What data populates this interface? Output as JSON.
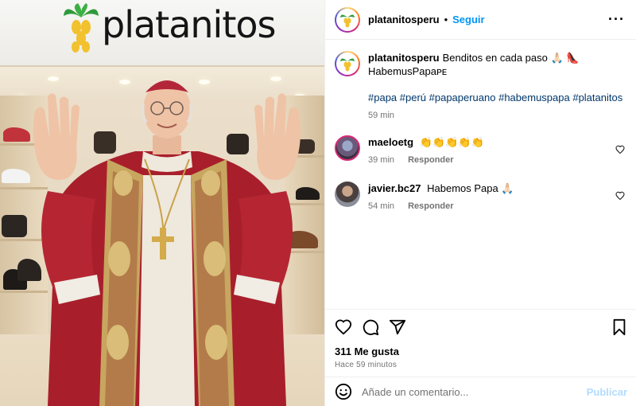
{
  "image": {
    "store_name": "platanitos"
  },
  "header": {
    "username": "platanitosperu",
    "separator": "•",
    "follow_label": "Seguir",
    "more": "···"
  },
  "caption": {
    "username": "platanitosperu",
    "text": "Benditos en cada paso 🙏🏻 👠",
    "text2": "HabemusPapaᴘᴇ",
    "hashtags": "#papa #perú #papaperuano #habemuspapa #platanitos",
    "time": "59 min"
  },
  "comments": [
    {
      "username": "maeloetg",
      "text": "👏👏👏👏👏",
      "time": "39 min",
      "reply": "Responder"
    },
    {
      "username": "javier.bc27",
      "text": "Habemos Papa 🙏🏻",
      "time": "54 min",
      "reply": "Responder"
    }
  ],
  "actions": {
    "likes": "311 Me gusta",
    "time_ago": "Hace 59 minutos"
  },
  "add_comment": {
    "placeholder": "Añade un comentario...",
    "publish_label": "Publicar"
  },
  "colors": {
    "link": "#0095f6",
    "hashtag": "#00376b",
    "muted": "#737373",
    "publish_disabled": "#b3dbff"
  }
}
